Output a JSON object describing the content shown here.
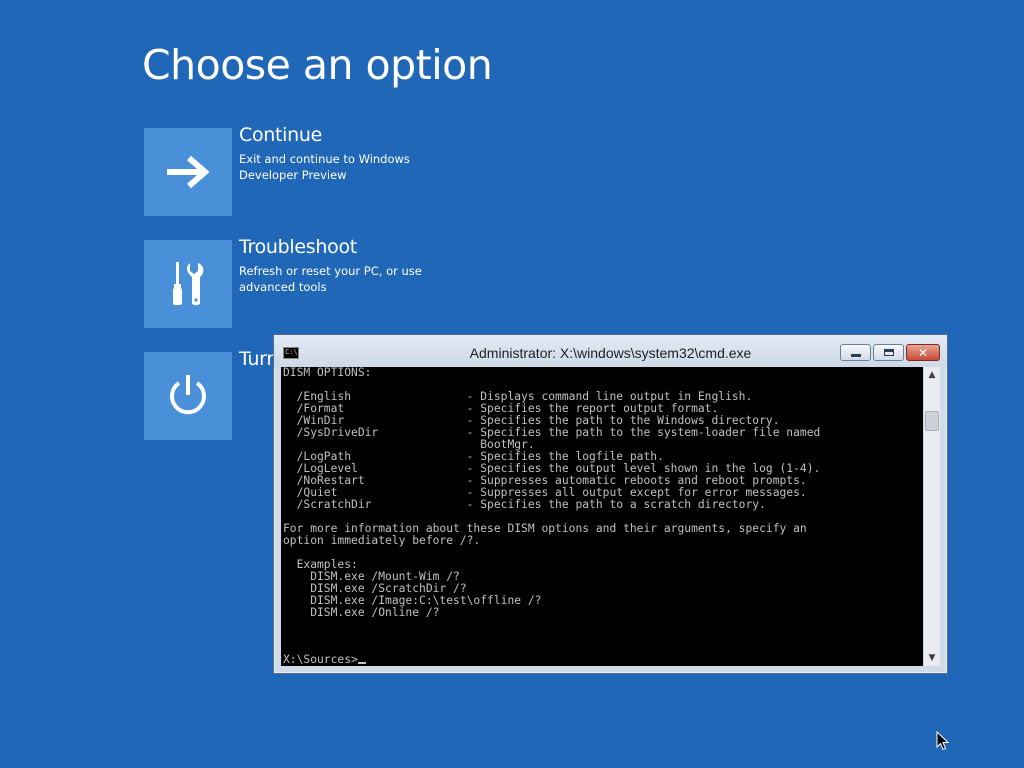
{
  "page_title": "Choose an option",
  "options": [
    {
      "title": "Continue",
      "description": "Exit and continue to Windows Developer Preview",
      "icon": "arrow-right-icon"
    },
    {
      "title": "Troubleshoot",
      "description": "Refresh or reset your PC, or use advanced tools",
      "icon": "tools-icon"
    },
    {
      "title": "Turn",
      "description": "",
      "icon": "power-icon"
    }
  ],
  "cmd_window": {
    "title": "Administrator: X:\\windows\\system32\\cmd.exe",
    "icon_label": "C:\\",
    "console_lines": [
      "DISM OPTIONS:",
      "",
      "  /English                 - Displays command line output in English.",
      "  /Format                  - Specifies the report output format.",
      "  /WinDir                  - Specifies the path to the Windows directory.",
      "  /SysDriveDir             - Specifies the path to the system-loader file named",
      "                             BootMgr.",
      "  /LogPath                 - Specifies the logfile path.",
      "  /LogLevel                - Specifies the output level shown in the log (1-4).",
      "  /NoRestart               - Suppresses automatic reboots and reboot prompts.",
      "  /Quiet                   - Suppresses all output except for error messages.",
      "  /ScratchDir              - Specifies the path to a scratch directory.",
      "",
      "For more information about these DISM options and their arguments, specify an",
      "option immediately before /?.",
      "",
      "  Examples:",
      "    DISM.exe /Mount-Wim /?",
      "    DISM.exe /ScratchDir /?",
      "    DISM.exe /Image:C:\\test\\offline /?",
      "    DISM.exe /Online /?"
    ],
    "prompt": "X:\\Sources>",
    "buttons": {
      "minimize": "minimize-icon",
      "maximize": "maximize-icon",
      "close": "close-icon"
    }
  }
}
